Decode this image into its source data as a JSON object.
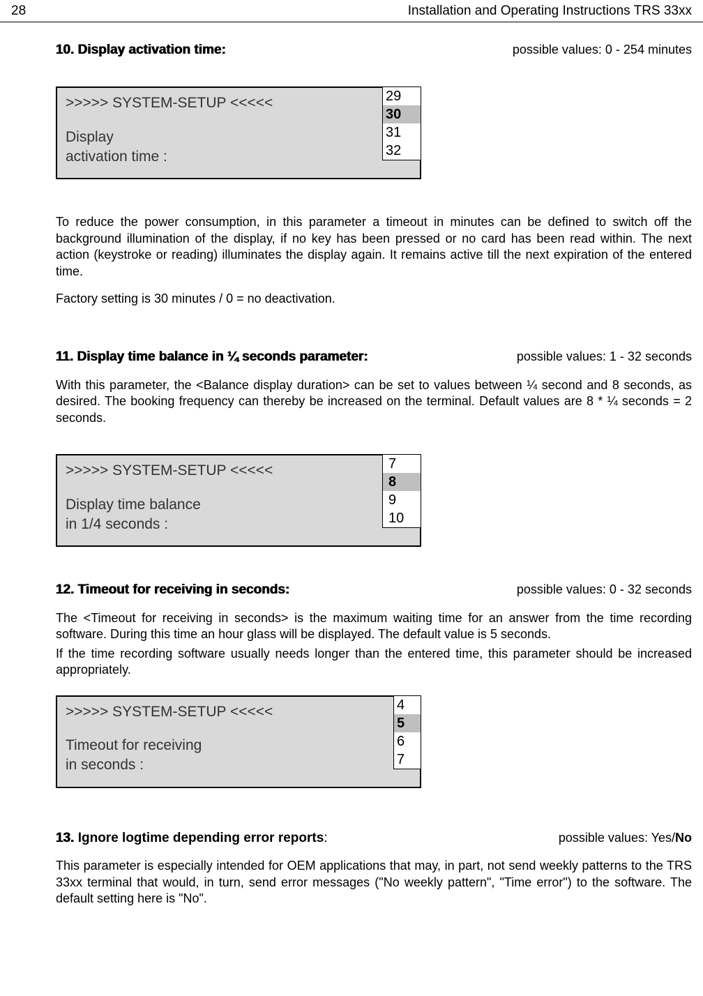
{
  "header": {
    "page_number": "28",
    "doc_title": "Installation  and Operating Instructions TRS 33xx"
  },
  "s10": {
    "title": "10. Display activation time:",
    "possible_values": "possible values: 0 - 254 minutes",
    "display": {
      "title": ">>>>> SYSTEM-SETUP <<<<<",
      "line1": "Display",
      "line2": "activation time :",
      "values": [
        "29",
        "30",
        "31",
        "32"
      ],
      "selected_index": 1
    },
    "para1": "To reduce the power consumption, in this parameter a timeout in minutes can be defined to switch off the background illumination of the display, if no key has been pressed or no card has been read within. The next action (keystroke or reading) illuminates the display again. It remains active till the next expiration of the entered time.",
    "para2": "Factory setting is 30 minutes / 0 = no deactivation."
  },
  "s11": {
    "title": "11. Display time balance in ¼ seconds parameter:",
    "possible_values": "possible values: 1 - 32 seconds",
    "para1": "With this parameter, the <Balance display duration> can be set to values between ¼ second and 8 seconds, as desired. The booking frequency can thereby be increased on the terminal. Default values are 8 * ¼ seconds = 2 seconds.",
    "display": {
      "title": ">>>>> SYSTEM-SETUP <<<<<",
      "line1": "Display time balance",
      "line2": "in 1/4 seconds :",
      "values": [
        "7",
        "8",
        "9",
        "10"
      ],
      "selected_index": 1
    }
  },
  "s12": {
    "title": "12. Timeout for receiving in seconds:",
    "possible_values": "possible values: 0 - 32 seconds",
    "para1": "The <Timeout for receiving in seconds> is the maximum waiting time for an answer from the time recording software. During this time an hour glass will be displayed. The default value is 5 seconds.",
    "para2": "If the time recording software usually needs longer than the entered time, this parameter should be increased appropriately.",
    "display": {
      "title": ">>>>> SYSTEM-SETUP <<<<<",
      "line1": "Timeout for receiving",
      "line2": "in seconds :",
      "values": [
        "4",
        "5",
        "6",
        "7"
      ],
      "selected_index": 1
    }
  },
  "s13": {
    "title_prefix": "13.",
    "title_rest": " Ignore logtime depending error reports",
    "title_colon": ":",
    "possible_values_prefix": "possible values: Yes/",
    "possible_values_bold": "No",
    "para1": "This parameter is especially intended for OEM applications that may, in part, not send weekly patterns to the TRS 33xx terminal that would, in turn, send error messages (\"No weekly pattern\", \"Time error\") to the software. The default setting here is \"No\"."
  }
}
